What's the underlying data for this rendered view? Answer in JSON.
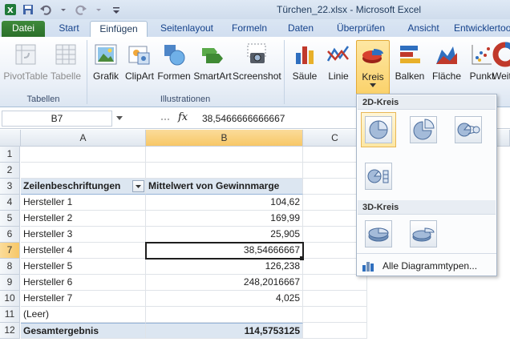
{
  "window": {
    "title": "Türchen_22.xlsx  -  Microsoft Excel"
  },
  "tabs": [
    {
      "label": "Datei"
    },
    {
      "label": "Start"
    },
    {
      "label": "Einfügen"
    },
    {
      "label": "Seitenlayout"
    },
    {
      "label": "Formeln"
    },
    {
      "label": "Daten"
    },
    {
      "label": "Überprüfen"
    },
    {
      "label": "Ansicht"
    },
    {
      "label": "Entwicklertools"
    }
  ],
  "ribbon": {
    "pivottable": "PivotTable",
    "tabelle": "Tabelle",
    "grafik": "Grafik",
    "clipart": "ClipArt",
    "formen": "Formen",
    "smartart": "SmartArt",
    "screenshot": "Screenshot",
    "saeule": "Säule",
    "linie": "Linie",
    "kreis": "Kreis",
    "balken": "Balken",
    "flaeche": "Fläche",
    "punkt": "Punkt",
    "weitere": "Weit",
    "group_tabellen": "Tabellen",
    "group_illustrationen": "Illustrationen"
  },
  "formula_bar": {
    "name_box": "B7",
    "fx": "fx",
    "value": "38,5466666666667"
  },
  "columns": [
    "A",
    "B",
    "C"
  ],
  "rows": [
    "1",
    "2",
    "3",
    "4",
    "5",
    "6",
    "7",
    "8",
    "9",
    "10",
    "11",
    "12"
  ],
  "pivot": {
    "header_a": "Zeilenbeschriftungen",
    "header_b": "Mittelwert von Gewinnmarge",
    "items": [
      {
        "label": "Hersteller 1",
        "value": "104,62"
      },
      {
        "label": "Hersteller 2",
        "value": "169,99"
      },
      {
        "label": "Hersteller 3",
        "value": "25,905"
      },
      {
        "label": "Hersteller 4",
        "value": "38,54666667"
      },
      {
        "label": "Hersteller 5",
        "value": "126,238"
      },
      {
        "label": "Hersteller 6",
        "value": "248,2016667"
      },
      {
        "label": "Hersteller 7",
        "value": "4,025"
      },
      {
        "label": "(Leer)",
        "value": ""
      }
    ],
    "total_label": "Gesamtergebnis",
    "total_value": "114,5753125"
  },
  "dropdown": {
    "section_2d": "2D-Kreis",
    "section_3d": "3D-Kreis",
    "all_types": "Alle Diagrammtypen..."
  },
  "colors": {
    "file_tab": "#2b6f2a",
    "accent": "#15428b",
    "pivot_header": "#dce6f1",
    "hover": "#fde7a3"
  }
}
